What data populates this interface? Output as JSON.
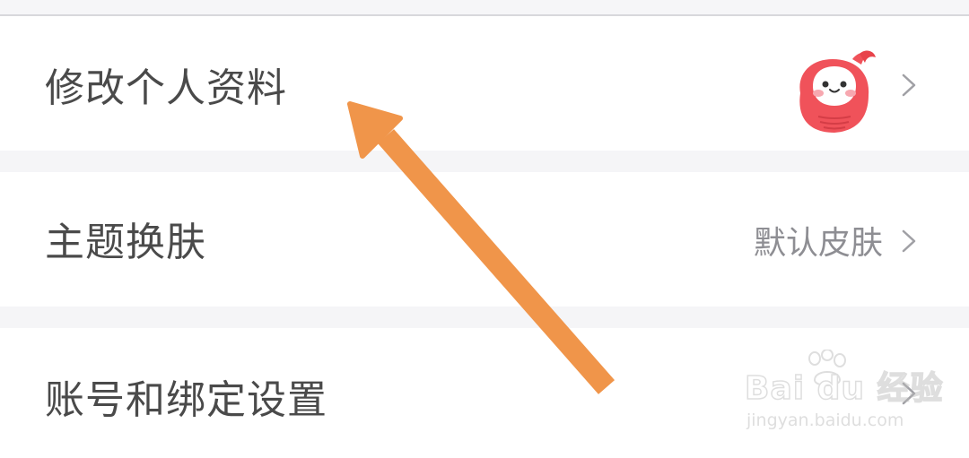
{
  "settings": {
    "items": [
      {
        "label": "修改个人资料",
        "value": "",
        "icon": "avatar-image",
        "chevron": "chevron-right-icon"
      },
      {
        "label": "主题换肤",
        "value": "默认皮肤",
        "chevron": "chevron-right-icon"
      },
      {
        "label": "账号和绑定设置",
        "value": "",
        "chevron": "chevron-right-icon"
      }
    ]
  },
  "annotation": {
    "arrow_color": "#f0954a",
    "points_to": "修改个人资料"
  },
  "watermark": {
    "brand": "Bai du 经验",
    "url": "jingyan.baidu.com"
  },
  "colors": {
    "label_text": "#4a4a4a",
    "value_text": "#8e8e93",
    "avatar_red": "#f0525a",
    "background": "#f5f5f7"
  }
}
